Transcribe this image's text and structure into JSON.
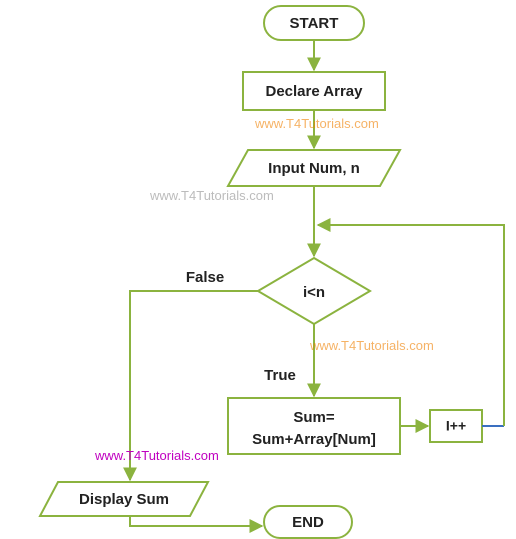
{
  "nodes": {
    "start": "START",
    "declare": "Declare Array",
    "input": "Input Num, n",
    "decision": "i<n",
    "sum_l1": "Sum=",
    "sum_l2": "Sum+Array[Num]",
    "inc": "I++",
    "display": "Display  Sum",
    "end": "END"
  },
  "edges": {
    "false_label": "False",
    "true_label": "True"
  },
  "watermarks": {
    "wm": "www.T4Tutorials.com"
  },
  "colors": {
    "stroke": "#8bb33f",
    "fill": "#ffffff",
    "arrow": "#8bb33f",
    "blue": "#3a6fc0"
  }
}
